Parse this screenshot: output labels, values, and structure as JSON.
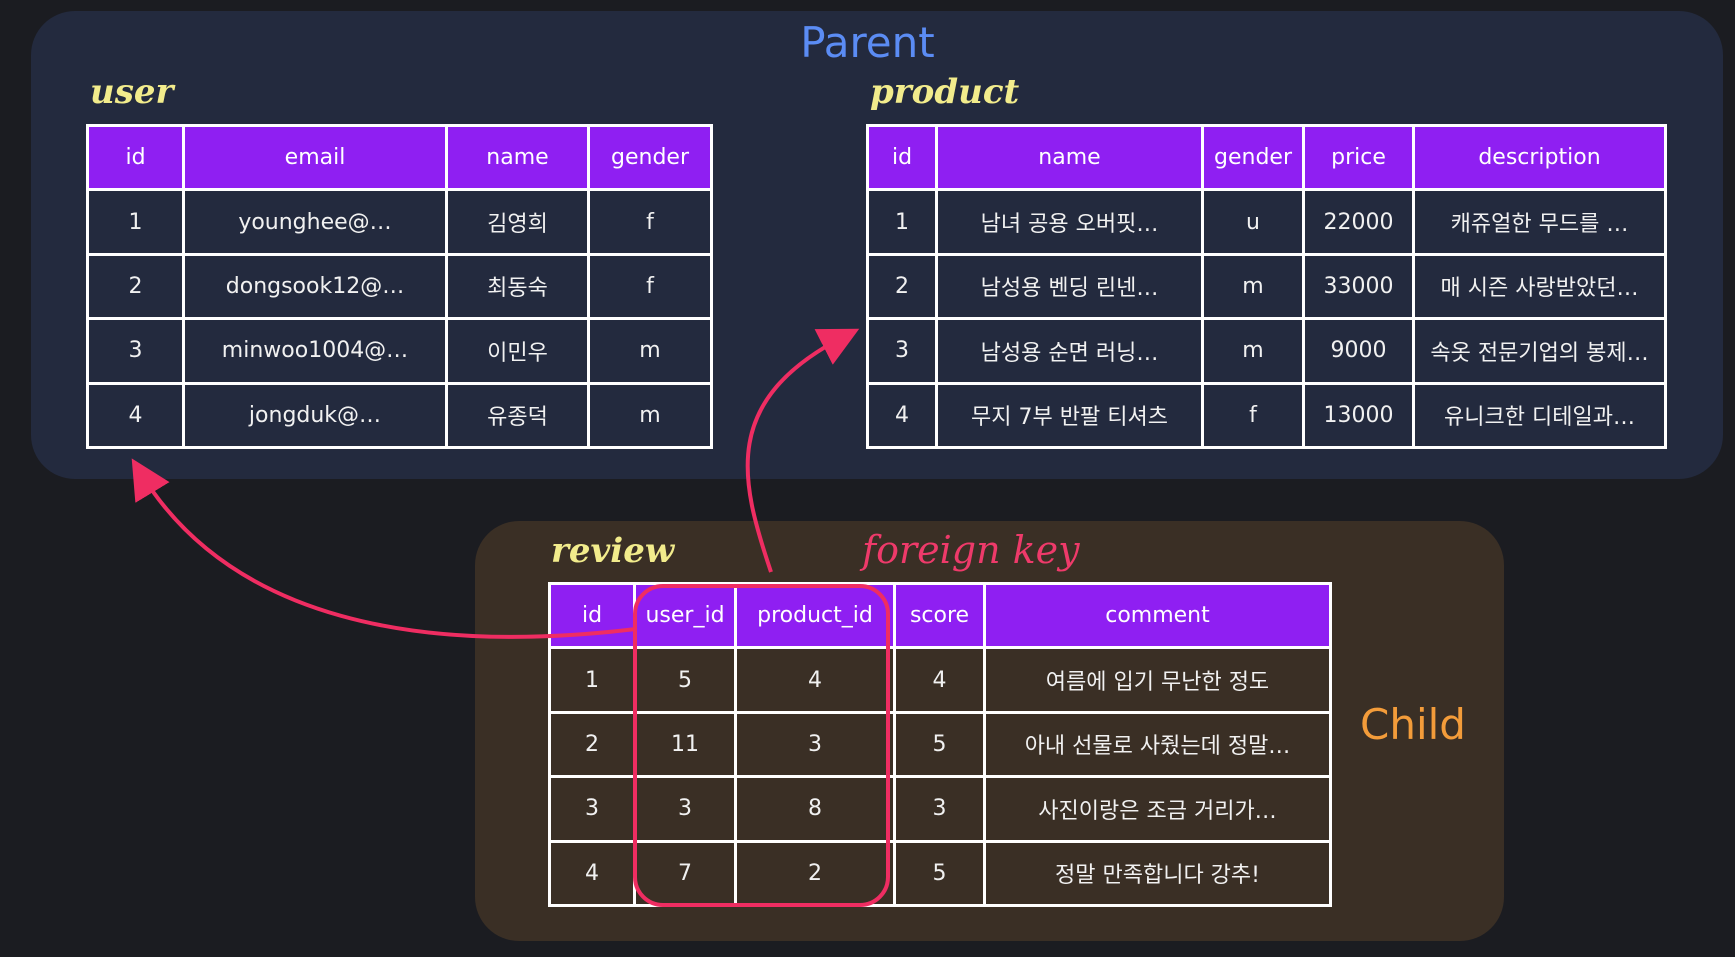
{
  "parent_title": "Parent",
  "child_title": "Child",
  "foreign_key_label": "foreign key",
  "colors": {
    "parent_bg": "#232a3e",
    "child_bg": "#3a2f25",
    "header_bg": "#8f1ff2",
    "arrow": "#ef2d62",
    "table_name": "#f2ec8c"
  },
  "user": {
    "name": "user",
    "headers": [
      "id",
      "email",
      "name",
      "gender"
    ],
    "rows": [
      [
        "1",
        "younghee@…",
        "김영희",
        "f"
      ],
      [
        "2",
        "dongsook12@…",
        "최동숙",
        "f"
      ],
      [
        "3",
        "minwoo1004@…",
        "이민우",
        "m"
      ],
      [
        "4",
        "jongduk@…",
        "유종덕",
        "m"
      ]
    ]
  },
  "product": {
    "name": "product",
    "headers": [
      "id",
      "name",
      "gender",
      "price",
      "description"
    ],
    "rows": [
      [
        "1",
        "남녀 공용 오버핏…",
        "u",
        "22000",
        "캐쥬얼한 무드를 …"
      ],
      [
        "2",
        "남성용 벤딩 린넨…",
        "m",
        "33000",
        "매 시즌 사랑받았던…"
      ],
      [
        "3",
        "남성용 순면 러닝…",
        "m",
        "9000",
        "속옷 전문기업의 봉제…"
      ],
      [
        "4",
        "무지 7부 반팔 티셔츠",
        "f",
        "13000",
        "유니크한 디테일과…"
      ]
    ]
  },
  "review": {
    "name": "review",
    "headers": [
      "id",
      "user_id",
      "product_id",
      "score",
      "comment"
    ],
    "rows": [
      [
        "1",
        "5",
        "4",
        "4",
        "여름에 입기 무난한 정도"
      ],
      [
        "2",
        "11",
        "3",
        "5",
        "아내 선물로 사줬는데 정말…"
      ],
      [
        "3",
        "3",
        "8",
        "3",
        "사진이랑은 조금 거리가…"
      ],
      [
        "4",
        "7",
        "2",
        "5",
        "정말 만족합니다 강추!"
      ]
    ]
  }
}
